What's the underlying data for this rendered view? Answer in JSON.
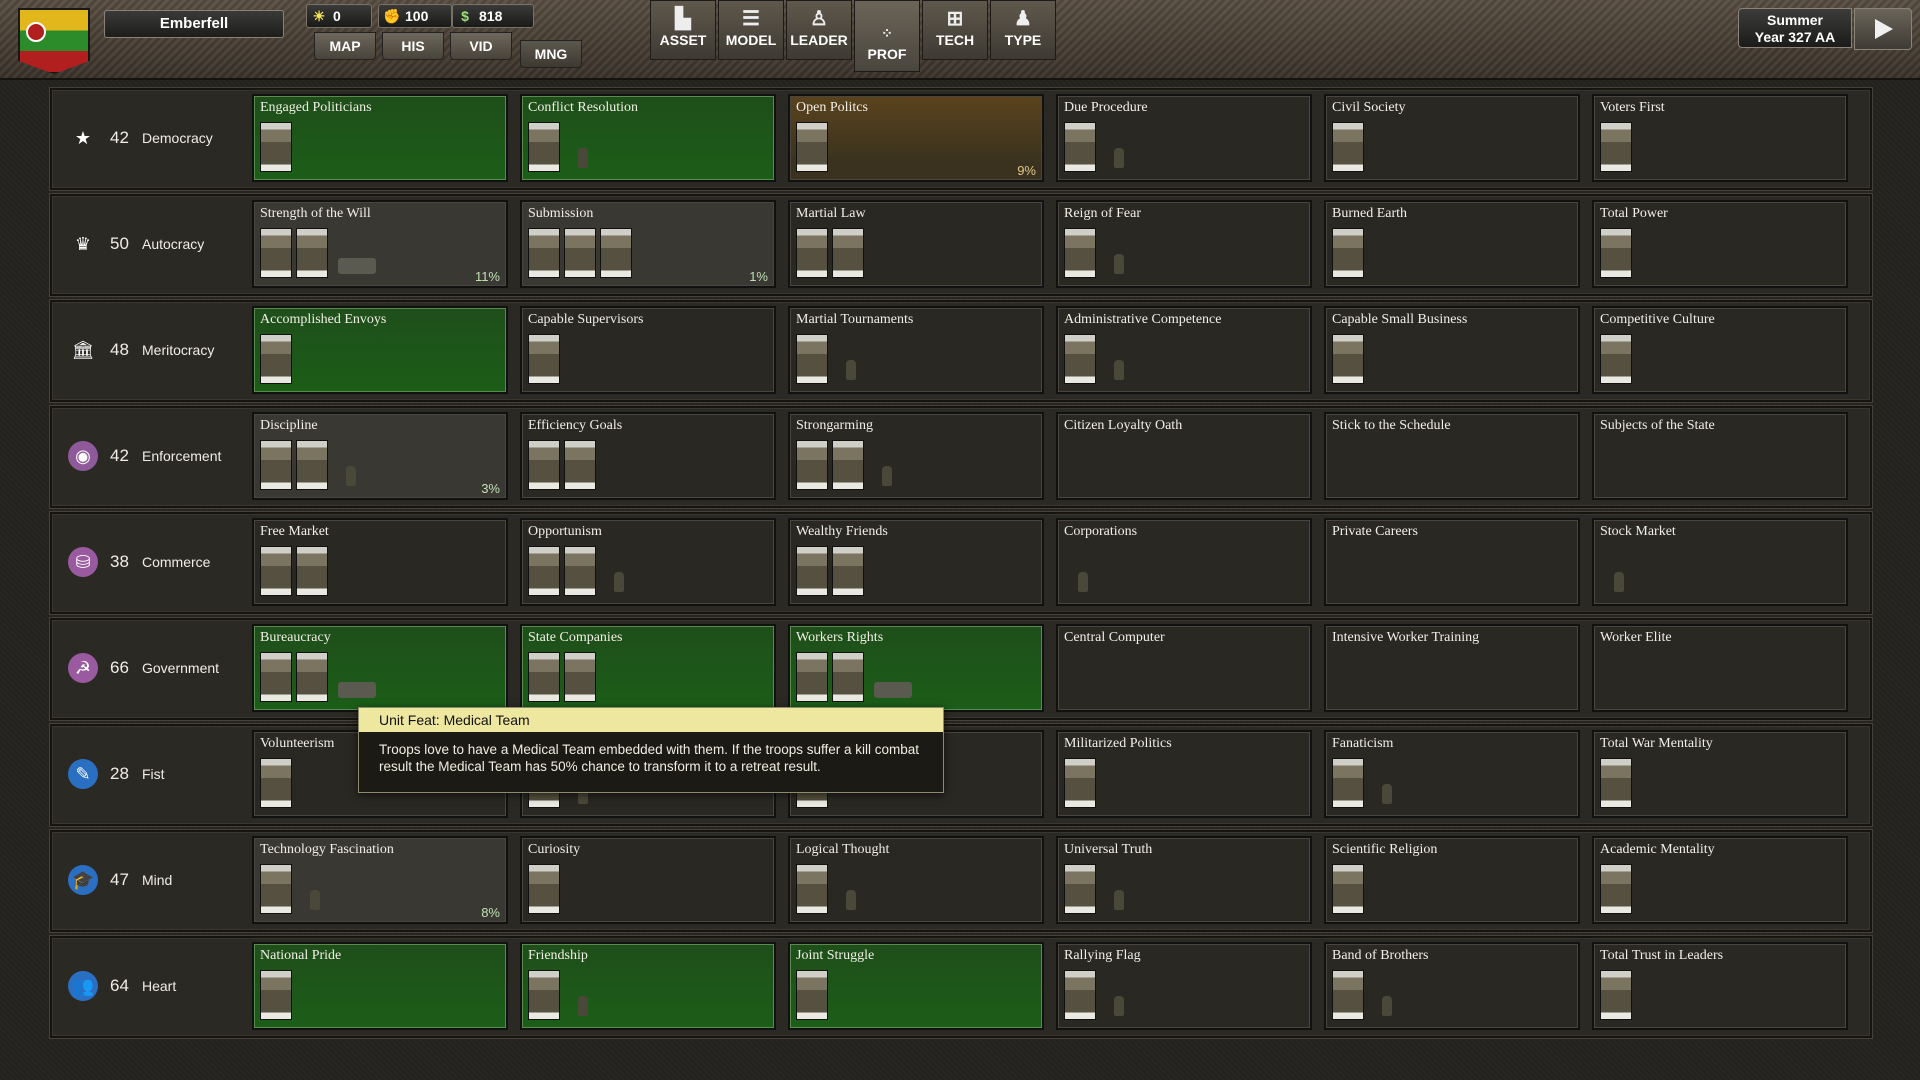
{
  "nation": "Emberfell",
  "resources": [
    {
      "icon": "sun-icon",
      "glyph": "☀",
      "value": "0"
    },
    {
      "icon": "fist-icon",
      "glyph": "✊",
      "value": "100"
    },
    {
      "icon": "money-icon",
      "glyph": "$",
      "value": "818"
    }
  ],
  "nav_tabs": [
    {
      "label": "MAP",
      "active": false
    },
    {
      "label": "HIS",
      "active": false
    },
    {
      "label": "VID",
      "active": false
    },
    {
      "label": "MNG",
      "active": true
    }
  ],
  "tool_buttons": [
    {
      "label": "ASSET",
      "icon": "buildings-icon",
      "glyph": "▙",
      "active": false
    },
    {
      "label": "MODEL",
      "icon": "sliders-icon",
      "glyph": "☰",
      "active": false
    },
    {
      "label": "LEADER",
      "icon": "leader-icon",
      "glyph": "♙",
      "active": false
    },
    {
      "label": "PROF",
      "icon": "profile-icon",
      "glyph": "⁘",
      "active": true
    },
    {
      "label": "TECH",
      "icon": "tech-icon",
      "glyph": "⊞",
      "active": false
    },
    {
      "label": "TYPE",
      "icon": "soldier-icon",
      "glyph": "♟",
      "active": false
    }
  ],
  "season": {
    "line1": "Summer",
    "line2": "Year 327 AA"
  },
  "rows": [
    {
      "name": "Democracy",
      "value": "42",
      "icon": "star-icon",
      "glyph": "★",
      "icon_bg": "transparent",
      "cards": [
        {
          "title": "Engaged Politicians",
          "state": "green",
          "thumbs": 1,
          "units": [],
          "pct": ""
        },
        {
          "title": "Conflict Resolution",
          "state": "green",
          "thumbs": 1,
          "units": [
            "inf"
          ],
          "pct": ""
        },
        {
          "title": "Open Politcs",
          "state": "amber",
          "thumbs": 1,
          "units": [],
          "pct": "9%"
        },
        {
          "title": "Due Procedure",
          "state": "dark",
          "thumbs": 1,
          "units": [
            "inf"
          ],
          "pct": ""
        },
        {
          "title": "Civil Society",
          "state": "dark",
          "thumbs": 1,
          "units": [],
          "pct": ""
        },
        {
          "title": "Voters First",
          "state": "dark",
          "thumbs": 1,
          "units": [],
          "pct": ""
        }
      ]
    },
    {
      "name": "Autocracy",
      "value": "50",
      "icon": "crown-icon",
      "glyph": "♛",
      "icon_bg": "transparent",
      "cards": [
        {
          "title": "Strength of the Will",
          "state": "gray",
          "thumbs": 2,
          "units": [
            "vehicle"
          ],
          "pct": "11%"
        },
        {
          "title": "Submission",
          "state": "gray",
          "thumbs": 3,
          "units": [],
          "pct": "1%"
        },
        {
          "title": "Martial Law",
          "state": "dark",
          "thumbs": 2,
          "units": [],
          "pct": ""
        },
        {
          "title": "Reign of Fear",
          "state": "dark",
          "thumbs": 1,
          "units": [
            "inf"
          ],
          "pct": ""
        },
        {
          "title": "Burned Earth",
          "state": "dark",
          "thumbs": 1,
          "units": [],
          "pct": ""
        },
        {
          "title": "Total Power",
          "state": "dark",
          "thumbs": 1,
          "units": [],
          "pct": ""
        }
      ]
    },
    {
      "name": "Meritocracy",
      "value": "48",
      "icon": "bank-icon",
      "glyph": "🏛",
      "icon_bg": "transparent",
      "cards": [
        {
          "title": "Accomplished Envoys",
          "state": "green",
          "thumbs": 1,
          "units": [],
          "pct": ""
        },
        {
          "title": "Capable Supervisors",
          "state": "dark",
          "thumbs": 1,
          "units": [],
          "pct": ""
        },
        {
          "title": "Martial Tournaments",
          "state": "dark",
          "thumbs": 1,
          "units": [
            "inf"
          ],
          "pct": ""
        },
        {
          "title": "Administrative Competence",
          "state": "dark",
          "thumbs": 1,
          "units": [
            "inf"
          ],
          "pct": ""
        },
        {
          "title": "Capable Small Business",
          "state": "dark",
          "thumbs": 1,
          "units": [],
          "pct": ""
        },
        {
          "title": "Competitive Culture",
          "state": "dark",
          "thumbs": 1,
          "units": [],
          "pct": ""
        }
      ]
    },
    {
      "name": "Enforcement",
      "value": "42",
      "icon": "eye-icon",
      "glyph": "◉",
      "icon_bg": "#8e5a9a",
      "cards": [
        {
          "title": "Discipline",
          "state": "gray",
          "thumbs": 2,
          "units": [
            "inf"
          ],
          "pct": "3%"
        },
        {
          "title": "Efficiency Goals",
          "state": "dark",
          "thumbs": 2,
          "units": [],
          "pct": ""
        },
        {
          "title": "Strongarming",
          "state": "dark",
          "thumbs": 2,
          "units": [
            "inf"
          ],
          "pct": ""
        },
        {
          "title": "Citizen Loyalty Oath",
          "state": "dark",
          "thumbs": 0,
          "units": [],
          "pct": ""
        },
        {
          "title": "Stick to the Schedule",
          "state": "dark",
          "thumbs": 0,
          "units": [],
          "pct": ""
        },
        {
          "title": "Subjects of the State",
          "state": "dark",
          "thumbs": 0,
          "units": [],
          "pct": ""
        }
      ]
    },
    {
      "name": "Commerce",
      "value": "38",
      "icon": "coins-icon",
      "glyph": "⛁",
      "icon_bg": "#9a5aa0",
      "cards": [
        {
          "title": "Free Market",
          "state": "dark",
          "thumbs": 2,
          "units": [],
          "pct": ""
        },
        {
          "title": "Opportunism",
          "state": "dark",
          "thumbs": 2,
          "units": [
            "inf"
          ],
          "pct": ""
        },
        {
          "title": "Wealthy Friends",
          "state": "dark",
          "thumbs": 2,
          "units": [],
          "pct": ""
        },
        {
          "title": "Corporations",
          "state": "dark",
          "thumbs": 0,
          "units": [
            "inf"
          ],
          "pct": ""
        },
        {
          "title": "Private Careers",
          "state": "dark",
          "thumbs": 0,
          "units": [],
          "pct": ""
        },
        {
          "title": "Stock Market",
          "state": "dark",
          "thumbs": 0,
          "units": [
            "inf"
          ],
          "pct": ""
        }
      ]
    },
    {
      "name": "Government",
      "value": "66",
      "icon": "hammer-sickle-icon",
      "glyph": "☭",
      "icon_bg": "#9a5aa0",
      "cards": [
        {
          "title": "Bureaucracy",
          "state": "green",
          "thumbs": 2,
          "units": [
            "vehicle"
          ],
          "pct": ""
        },
        {
          "title": "State Companies",
          "state": "green",
          "thumbs": 2,
          "units": [],
          "pct": ""
        },
        {
          "title": "Workers Rights",
          "state": "green",
          "thumbs": 2,
          "units": [
            "vehicle"
          ],
          "pct": ""
        },
        {
          "title": "Central Computer",
          "state": "dark",
          "thumbs": 0,
          "units": [],
          "pct": ""
        },
        {
          "title": "Intensive Worker Training",
          "state": "dark",
          "thumbs": 0,
          "units": [],
          "pct": ""
        },
        {
          "title": "Worker Elite",
          "state": "dark",
          "thumbs": 0,
          "units": [],
          "pct": ""
        }
      ]
    },
    {
      "name": "Fist",
      "value": "28",
      "icon": "pen-icon",
      "glyph": "✎",
      "icon_bg": "#2a6fc2",
      "cards": [
        {
          "title": "Volunteerism",
          "state": "dark",
          "thumbs": 1,
          "units": [],
          "pct": ""
        },
        {
          "title": "",
          "state": "dark",
          "thumbs": 1,
          "units": [
            "inf"
          ],
          "pct": ""
        },
        {
          "title": "",
          "state": "dark",
          "thumbs": 1,
          "units": [],
          "pct": ""
        },
        {
          "title": "Militarized Politics",
          "state": "dark",
          "thumbs": 1,
          "units": [],
          "pct": ""
        },
        {
          "title": "Fanaticism",
          "state": "dark",
          "thumbs": 1,
          "units": [
            "inf"
          ],
          "pct": ""
        },
        {
          "title": "Total War Mentality",
          "state": "dark",
          "thumbs": 1,
          "units": [],
          "pct": ""
        }
      ]
    },
    {
      "name": "Mind",
      "value": "47",
      "icon": "graduation-cap-icon",
      "glyph": "🎓",
      "icon_bg": "#2a6fc2",
      "cards": [
        {
          "title": "Technology Fascination",
          "state": "gray",
          "thumbs": 1,
          "units": [
            "inf"
          ],
          "pct": "8%"
        },
        {
          "title": "Curiosity",
          "state": "dark",
          "thumbs": 1,
          "units": [],
          "pct": ""
        },
        {
          "title": "Logical Thought",
          "state": "dark",
          "thumbs": 1,
          "units": [
            "inf"
          ],
          "pct": ""
        },
        {
          "title": "Universal Truth",
          "state": "dark",
          "thumbs": 1,
          "units": [
            "inf"
          ],
          "pct": ""
        },
        {
          "title": "Scientific Religion",
          "state": "dark",
          "thumbs": 1,
          "units": [],
          "pct": ""
        },
        {
          "title": "Academic Mentality",
          "state": "dark",
          "thumbs": 1,
          "units": [],
          "pct": ""
        }
      ]
    },
    {
      "name": "Heart",
      "value": "64",
      "icon": "people-icon",
      "glyph": "👥",
      "icon_bg": "#2a6fc2",
      "cards": [
        {
          "title": "National Pride",
          "state": "green",
          "thumbs": 1,
          "units": [],
          "pct": ""
        },
        {
          "title": "Friendship",
          "state": "green",
          "thumbs": 1,
          "units": [
            "inf"
          ],
          "pct": ""
        },
        {
          "title": "Joint Struggle",
          "state": "green",
          "thumbs": 1,
          "units": [],
          "pct": ""
        },
        {
          "title": "Rallying Flag",
          "state": "dark",
          "thumbs": 1,
          "units": [
            "inf"
          ],
          "pct": ""
        },
        {
          "title": "Band of Brothers",
          "state": "dark",
          "thumbs": 1,
          "units": [
            "inf"
          ],
          "pct": ""
        },
        {
          "title": "Total Trust in Leaders",
          "state": "dark",
          "thumbs": 1,
          "units": [],
          "pct": ""
        }
      ]
    }
  ],
  "tooltip": {
    "title": "Unit Feat: Medical Team",
    "body": "Troops love to have a Medical Team embedded with them. If the troops suffer a kill combat result the Medical Team has 50% chance to transform it to a retreat result."
  }
}
